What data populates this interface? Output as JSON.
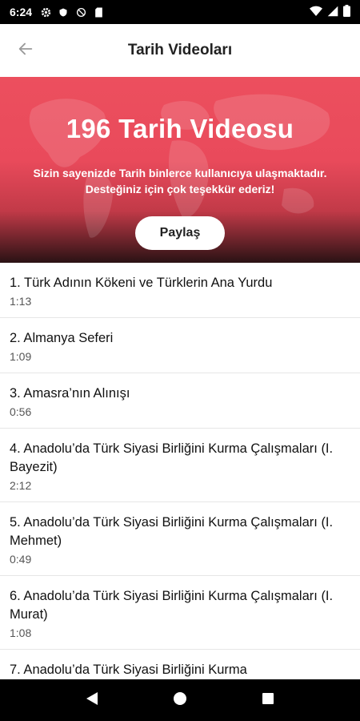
{
  "status_bar": {
    "time": "6:24",
    "icons_left": [
      "gear-icon",
      "shield-icon",
      "no-sync-icon",
      "sd-card-icon"
    ],
    "icons_right": [
      "wifi-icon",
      "signal-icon",
      "battery-icon"
    ]
  },
  "app_bar": {
    "title": "Tarih Videoları",
    "back_icon": "arrow-left-icon"
  },
  "banner": {
    "title": "196 Tarih Videosu",
    "description": "Sizin sayenizde Tarih binlerce kullanıcıya ulaşmaktadır. Desteğiniz için çok teşekkür ederiz!",
    "share_label": "Paylaş",
    "colors": {
      "top": "#ec4f5e",
      "bottom": "#2a1214"
    }
  },
  "videos": [
    {
      "title": "1. Türk Adının Kökeni ve Türklerin Ana Yurdu",
      "duration": "1:13"
    },
    {
      "title": "2. Almanya Seferi",
      "duration": "1:09"
    },
    {
      "title": "3. Amasra’nın Alınışı",
      "duration": "0:56"
    },
    {
      "title": "4. Anadolu’da Türk Siyasi Birliğini Kurma Çalışmaları (I. Bayezit)",
      "duration": "2:12"
    },
    {
      "title": "5. Anadolu’da Türk Siyasi Birliğini Kurma Çalışmaları (I. Mehmet)",
      "duration": "0:49"
    },
    {
      "title": "6. Anadolu’da Türk Siyasi Birliğini Kurma Çalışmaları (I. Murat)",
      "duration": "1:08"
    },
    {
      "title": "7. Anadolu’da Türk Siyasi Birliğini Kurma",
      "duration": ""
    }
  ],
  "nav_bar": {
    "icons": [
      "back-triangle-icon",
      "home-circle-icon",
      "recents-square-icon"
    ]
  }
}
